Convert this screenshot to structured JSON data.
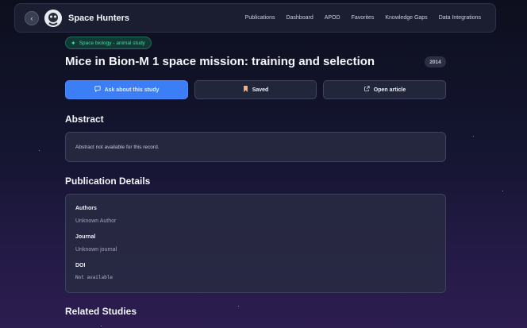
{
  "brand": {
    "name": "Space Hunters"
  },
  "nav": {
    "links": [
      "Publications",
      "Dashboard",
      "APOD",
      "Favorites",
      "Knowledge Gaps",
      "Data Integrations"
    ]
  },
  "study": {
    "tag": "Space biology - animal study",
    "title": "Mice in Bion-M 1 space mission: training and selection",
    "year": "2014"
  },
  "actions": {
    "ask": "Ask about this study",
    "saved": "Saved",
    "open": "Open article"
  },
  "abstract": {
    "heading": "Abstract",
    "text": "Abstract not available for this record."
  },
  "details": {
    "heading": "Publication Details",
    "authors_label": "Authors",
    "authors_value": "Unknown Author",
    "journal_label": "Journal",
    "journal_value": "Unknown journal",
    "doi_label": "DOI",
    "doi_value": "Not available"
  },
  "related": {
    "heading": "Related Studies"
  },
  "colors": {
    "accent": "#3c7ef6",
    "tag_green": "#45d6a6",
    "surface": "#22263a"
  }
}
